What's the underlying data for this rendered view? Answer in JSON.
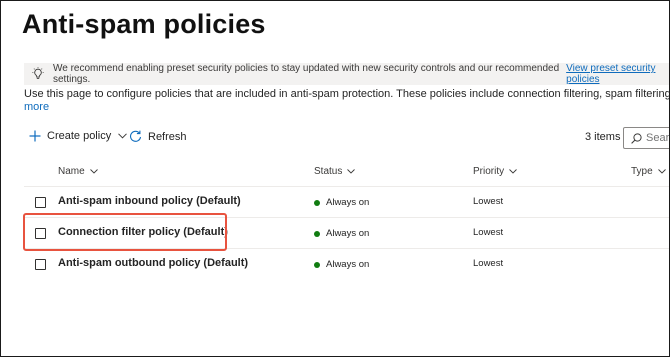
{
  "page": {
    "title": "Anti-spam policies"
  },
  "banner": {
    "icon": "lightbulb-icon",
    "text": "We recommend enabling preset security policies to stay updated with new security controls and our recommended settings.",
    "link": "View preset security policies"
  },
  "description": {
    "text": "Use this page to configure policies that are included in anti-spam protection. These policies include connection filtering, spam filtering, and outbo",
    "more": "more"
  },
  "toolbar": {
    "create_label": "Create policy",
    "refresh_label": "Refresh",
    "items_count": "3 items",
    "search_placeholder": "Searc"
  },
  "table": {
    "columns": {
      "name": "Name",
      "status": "Status",
      "priority": "Priority",
      "type": "Type"
    },
    "rows": [
      {
        "name": "Anti-spam inbound policy (Default)",
        "status": "Always on",
        "priority": "Lowest"
      },
      {
        "name": "Connection filter policy (Default)",
        "status": "Always on",
        "priority": "Lowest"
      },
      {
        "name": "Anti-spam outbound policy (Default)",
        "status": "Always on",
        "priority": "Lowest"
      }
    ]
  },
  "colors": {
    "link": "#0f6cbd",
    "status_on": "#107c10",
    "highlight": "#e8533f"
  }
}
